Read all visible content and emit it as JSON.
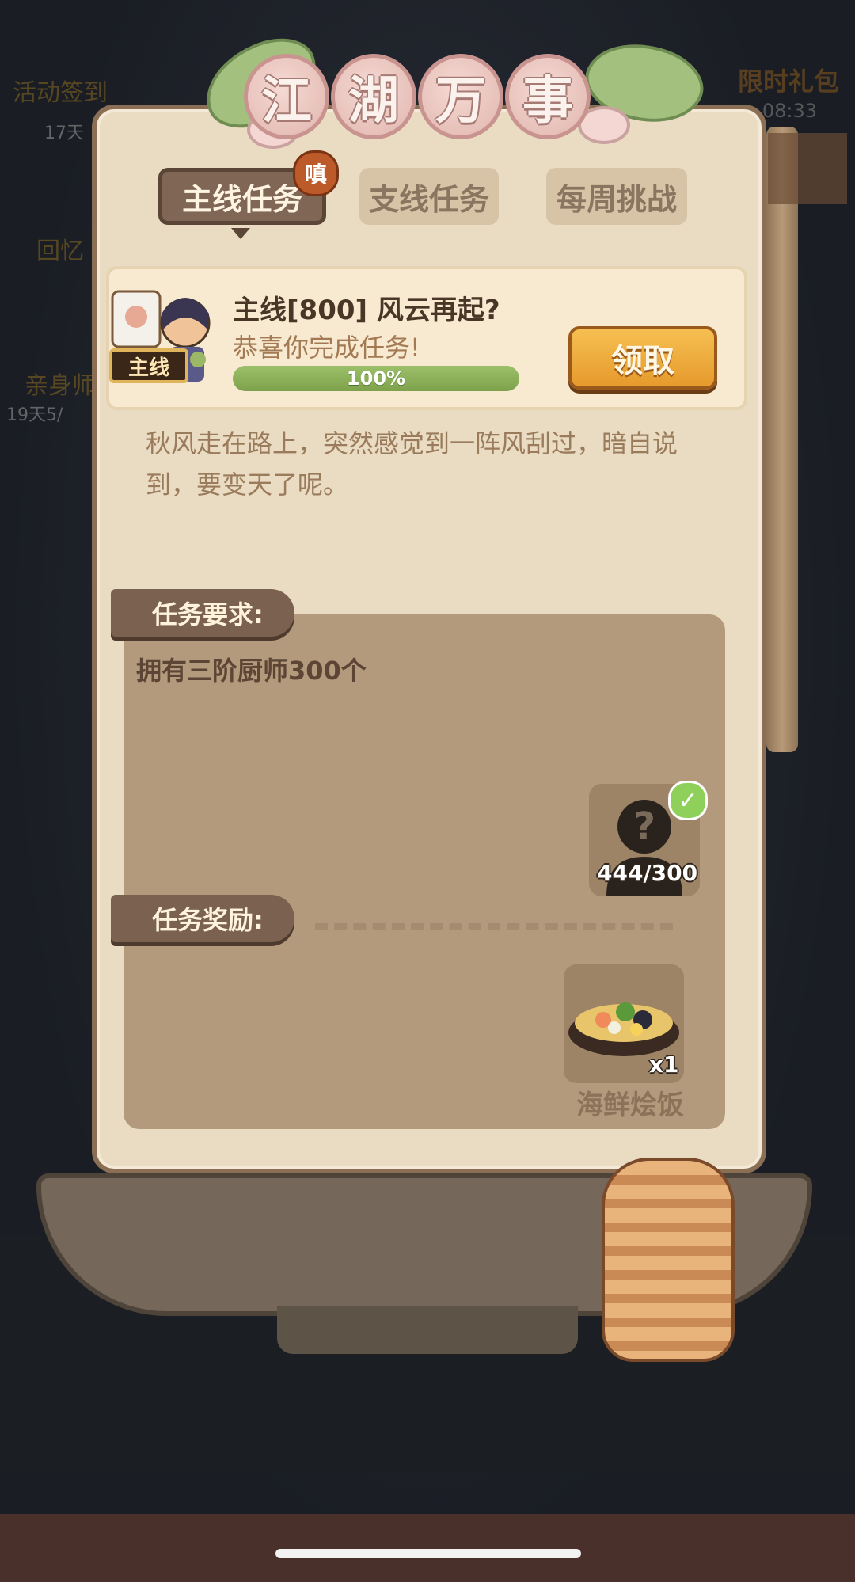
{
  "background": {
    "left_items": [
      {
        "label": "活动签到",
        "sub": "17天"
      },
      {
        "label": "回忆",
        "sub": ""
      },
      {
        "label": "亲身师",
        "sub": "19天5/"
      }
    ],
    "right_item": {
      "label": "限时礼包",
      "sub": "08:33"
    }
  },
  "title": [
    "江",
    "湖",
    "万",
    "事"
  ],
  "tabs": [
    {
      "label": "主线任务",
      "active": true
    },
    {
      "label": "支线任务",
      "active": false
    },
    {
      "label": "每周挑战",
      "active": false
    }
  ],
  "tab_badge": "嗔",
  "quest": {
    "tag": "主线",
    "title": "主线[800] 风云再起?",
    "subtitle": "恭喜你完成任务!",
    "progress_text": "100%",
    "progress_fraction": 1.0,
    "claim_label": "领取"
  },
  "description": "秋风走在路上，突然感觉到一阵风刮过，暗自说到，要变天了呢。",
  "requirement": {
    "header": "任务要求:",
    "text": "拥有三阶厨师300个",
    "item_count": "444/300",
    "completed": true
  },
  "reward": {
    "header": "任务奖励:",
    "item_count": "x1",
    "item_name": "海鲜烩饭"
  },
  "colors": {
    "panel": "#eadcc2",
    "active_tab": "#806755",
    "claim_button": "#f0ad40",
    "progress": "#8db45a"
  }
}
